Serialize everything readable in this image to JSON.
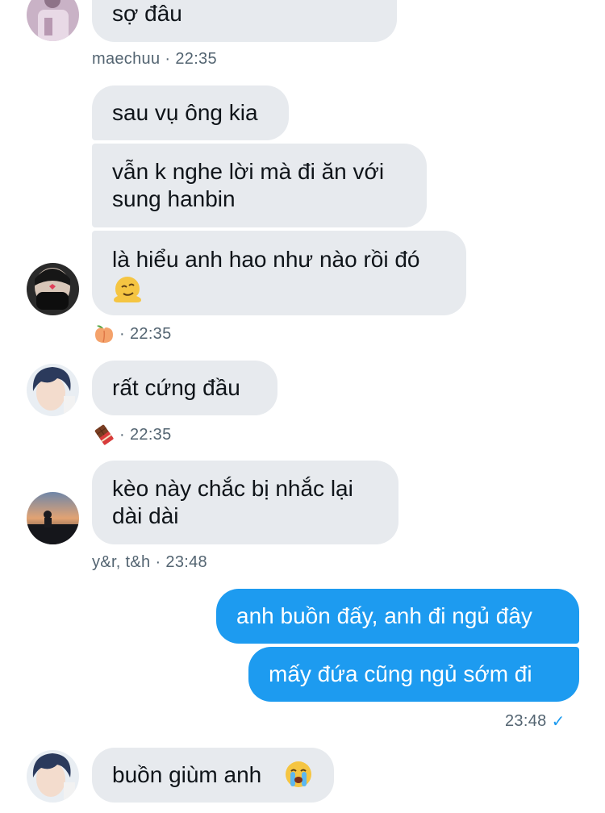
{
  "messages": {
    "m1_text": "sợ đâu",
    "m1_meta_user": "maechuu",
    "m1_meta_time": "22:35",
    "m2_text": "sau vụ ông kia",
    "m3_line1": "vẫn k nghe lời mà đi ăn với",
    "m3_line2": "sung hanbin",
    "m4_line1": "là hiểu anh hao như nào rồi đó",
    "m4_emoji": "melting-face-icon",
    "m4_meta_emoji": "peach-icon",
    "m4_meta_time": "22:35",
    "m5_text": "rất cứng đầu",
    "m5_meta_emoji": "chocolate-bar-icon",
    "m5_meta_time": "22:35",
    "m6_line1": "kèo này chắc bị nhắc lại",
    "m6_line2": "dài dài",
    "m6_meta_user": "y&r, t&h",
    "m6_meta_time": "23:48",
    "m7_text": "anh buồn đấy, anh đi ngủ đây",
    "m8_text": "mấy đứa cũng ngủ sớm đi",
    "m8_meta_time": "23:48",
    "m8_meta_check": "✓",
    "m9_text": "buồn giùm anh",
    "m9_emoji": "loudly-crying-face-icon"
  },
  "meta_separator": "·",
  "colors": {
    "incoming_bubble": "#e7eaee",
    "outgoing_bubble": "#1d9bf0",
    "meta_text": "#536471"
  }
}
